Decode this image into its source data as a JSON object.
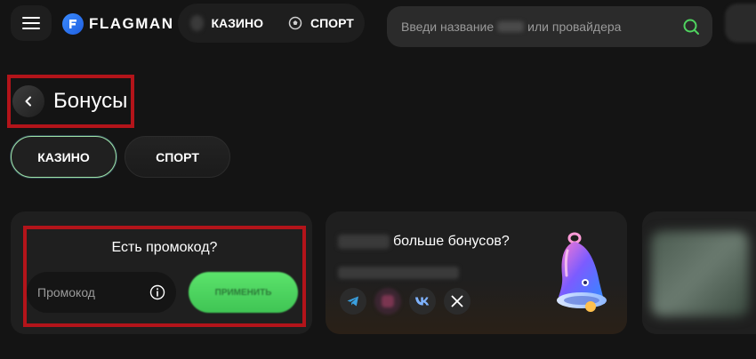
{
  "header": {
    "logo_text": "FLAGMAN",
    "nav": [
      {
        "label": "КАЗИНО"
      },
      {
        "label": "СПОРТ"
      }
    ],
    "search": {
      "placeholder_start": "Введи название",
      "placeholder_end": "или провайдера"
    }
  },
  "page": {
    "title": "Бонусы",
    "tabs": [
      {
        "label": "КАЗИНО",
        "active": true
      },
      {
        "label": "СПОРТ",
        "active": false
      }
    ]
  },
  "promo": {
    "title": "Есть промокод?",
    "input_placeholder": "Промокод",
    "apply_label": "ПРИМЕНИТЬ"
  },
  "social": {
    "title_suffix": "больше бонусов?",
    "icons": [
      "telegram-icon",
      "instagram-icon",
      "vk-icon",
      "x-icon"
    ]
  },
  "colors": {
    "background": "#141414",
    "accent_green": "#4fd35f",
    "highlight_red": "#b3141a",
    "logo_blue": "#2f7dff"
  }
}
